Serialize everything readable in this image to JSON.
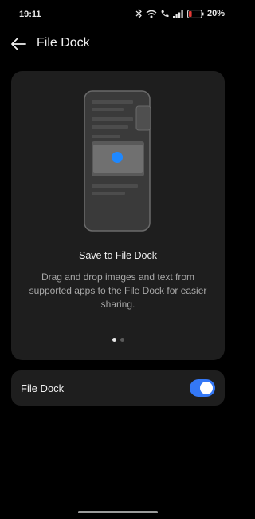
{
  "status_bar": {
    "time": "19:11",
    "battery_percent": "20%",
    "icons": [
      "bluetooth-icon",
      "wifi-icon",
      "call-icon",
      "signal-icon",
      "battery-icon"
    ]
  },
  "header": {
    "title": "File Dock",
    "back_icon": "arrow-left-icon"
  },
  "feature_card": {
    "title": "Save to File Dock",
    "description": "Drag and drop images and text from supported apps to the File Dock for easier sharing.",
    "pager": {
      "total": 2,
      "active_index": 0
    }
  },
  "setting": {
    "label": "File Dock",
    "enabled": true
  },
  "colors": {
    "background": "#000000",
    "card": "#1e1e1e",
    "accent": "#3478f6",
    "battery_low": "#e53935"
  }
}
